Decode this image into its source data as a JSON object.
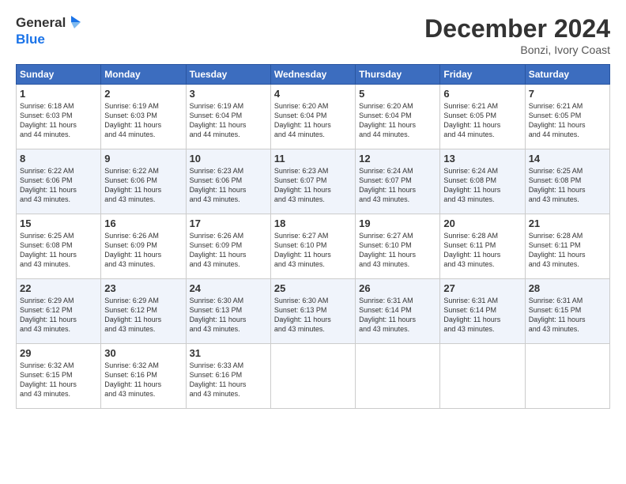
{
  "logo": {
    "line1": "General",
    "line2": "Blue"
  },
  "title": "December 2024",
  "location": "Bonzi, Ivory Coast",
  "days_of_week": [
    "Sunday",
    "Monday",
    "Tuesday",
    "Wednesday",
    "Thursday",
    "Friday",
    "Saturday"
  ],
  "weeks": [
    [
      {
        "day": "1",
        "sunrise": "6:18 AM",
        "sunset": "6:03 PM",
        "daylight": "11 hours and 44 minutes."
      },
      {
        "day": "2",
        "sunrise": "6:19 AM",
        "sunset": "6:03 PM",
        "daylight": "11 hours and 44 minutes."
      },
      {
        "day": "3",
        "sunrise": "6:19 AM",
        "sunset": "6:04 PM",
        "daylight": "11 hours and 44 minutes."
      },
      {
        "day": "4",
        "sunrise": "6:20 AM",
        "sunset": "6:04 PM",
        "daylight": "11 hours and 44 minutes."
      },
      {
        "day": "5",
        "sunrise": "6:20 AM",
        "sunset": "6:04 PM",
        "daylight": "11 hours and 44 minutes."
      },
      {
        "day": "6",
        "sunrise": "6:21 AM",
        "sunset": "6:05 PM",
        "daylight": "11 hours and 44 minutes."
      },
      {
        "day": "7",
        "sunrise": "6:21 AM",
        "sunset": "6:05 PM",
        "daylight": "11 hours and 44 minutes."
      }
    ],
    [
      {
        "day": "8",
        "sunrise": "6:22 AM",
        "sunset": "6:06 PM",
        "daylight": "11 hours and 43 minutes."
      },
      {
        "day": "9",
        "sunrise": "6:22 AM",
        "sunset": "6:06 PM",
        "daylight": "11 hours and 43 minutes."
      },
      {
        "day": "10",
        "sunrise": "6:23 AM",
        "sunset": "6:06 PM",
        "daylight": "11 hours and 43 minutes."
      },
      {
        "day": "11",
        "sunrise": "6:23 AM",
        "sunset": "6:07 PM",
        "daylight": "11 hours and 43 minutes."
      },
      {
        "day": "12",
        "sunrise": "6:24 AM",
        "sunset": "6:07 PM",
        "daylight": "11 hours and 43 minutes."
      },
      {
        "day": "13",
        "sunrise": "6:24 AM",
        "sunset": "6:08 PM",
        "daylight": "11 hours and 43 minutes."
      },
      {
        "day": "14",
        "sunrise": "6:25 AM",
        "sunset": "6:08 PM",
        "daylight": "11 hours and 43 minutes."
      }
    ],
    [
      {
        "day": "15",
        "sunrise": "6:25 AM",
        "sunset": "6:08 PM",
        "daylight": "11 hours and 43 minutes."
      },
      {
        "day": "16",
        "sunrise": "6:26 AM",
        "sunset": "6:09 PM",
        "daylight": "11 hours and 43 minutes."
      },
      {
        "day": "17",
        "sunrise": "6:26 AM",
        "sunset": "6:09 PM",
        "daylight": "11 hours and 43 minutes."
      },
      {
        "day": "18",
        "sunrise": "6:27 AM",
        "sunset": "6:10 PM",
        "daylight": "11 hours and 43 minutes."
      },
      {
        "day": "19",
        "sunrise": "6:27 AM",
        "sunset": "6:10 PM",
        "daylight": "11 hours and 43 minutes."
      },
      {
        "day": "20",
        "sunrise": "6:28 AM",
        "sunset": "6:11 PM",
        "daylight": "11 hours and 43 minutes."
      },
      {
        "day": "21",
        "sunrise": "6:28 AM",
        "sunset": "6:11 PM",
        "daylight": "11 hours and 43 minutes."
      }
    ],
    [
      {
        "day": "22",
        "sunrise": "6:29 AM",
        "sunset": "6:12 PM",
        "daylight": "11 hours and 43 minutes."
      },
      {
        "day": "23",
        "sunrise": "6:29 AM",
        "sunset": "6:12 PM",
        "daylight": "11 hours and 43 minutes."
      },
      {
        "day": "24",
        "sunrise": "6:30 AM",
        "sunset": "6:13 PM",
        "daylight": "11 hours and 43 minutes."
      },
      {
        "day": "25",
        "sunrise": "6:30 AM",
        "sunset": "6:13 PM",
        "daylight": "11 hours and 43 minutes."
      },
      {
        "day": "26",
        "sunrise": "6:31 AM",
        "sunset": "6:14 PM",
        "daylight": "11 hours and 43 minutes."
      },
      {
        "day": "27",
        "sunrise": "6:31 AM",
        "sunset": "6:14 PM",
        "daylight": "11 hours and 43 minutes."
      },
      {
        "day": "28",
        "sunrise": "6:31 AM",
        "sunset": "6:15 PM",
        "daylight": "11 hours and 43 minutes."
      }
    ],
    [
      {
        "day": "29",
        "sunrise": "6:32 AM",
        "sunset": "6:15 PM",
        "daylight": "11 hours and 43 minutes."
      },
      {
        "day": "30",
        "sunrise": "6:32 AM",
        "sunset": "6:16 PM",
        "daylight": "11 hours and 43 minutes."
      },
      {
        "day": "31",
        "sunrise": "6:33 AM",
        "sunset": "6:16 PM",
        "daylight": "11 hours and 43 minutes."
      },
      null,
      null,
      null,
      null
    ]
  ],
  "cell_labels": {
    "sunrise_prefix": "Sunrise: ",
    "sunset_prefix": "Sunset: ",
    "daylight_prefix": "Daylight: "
  }
}
